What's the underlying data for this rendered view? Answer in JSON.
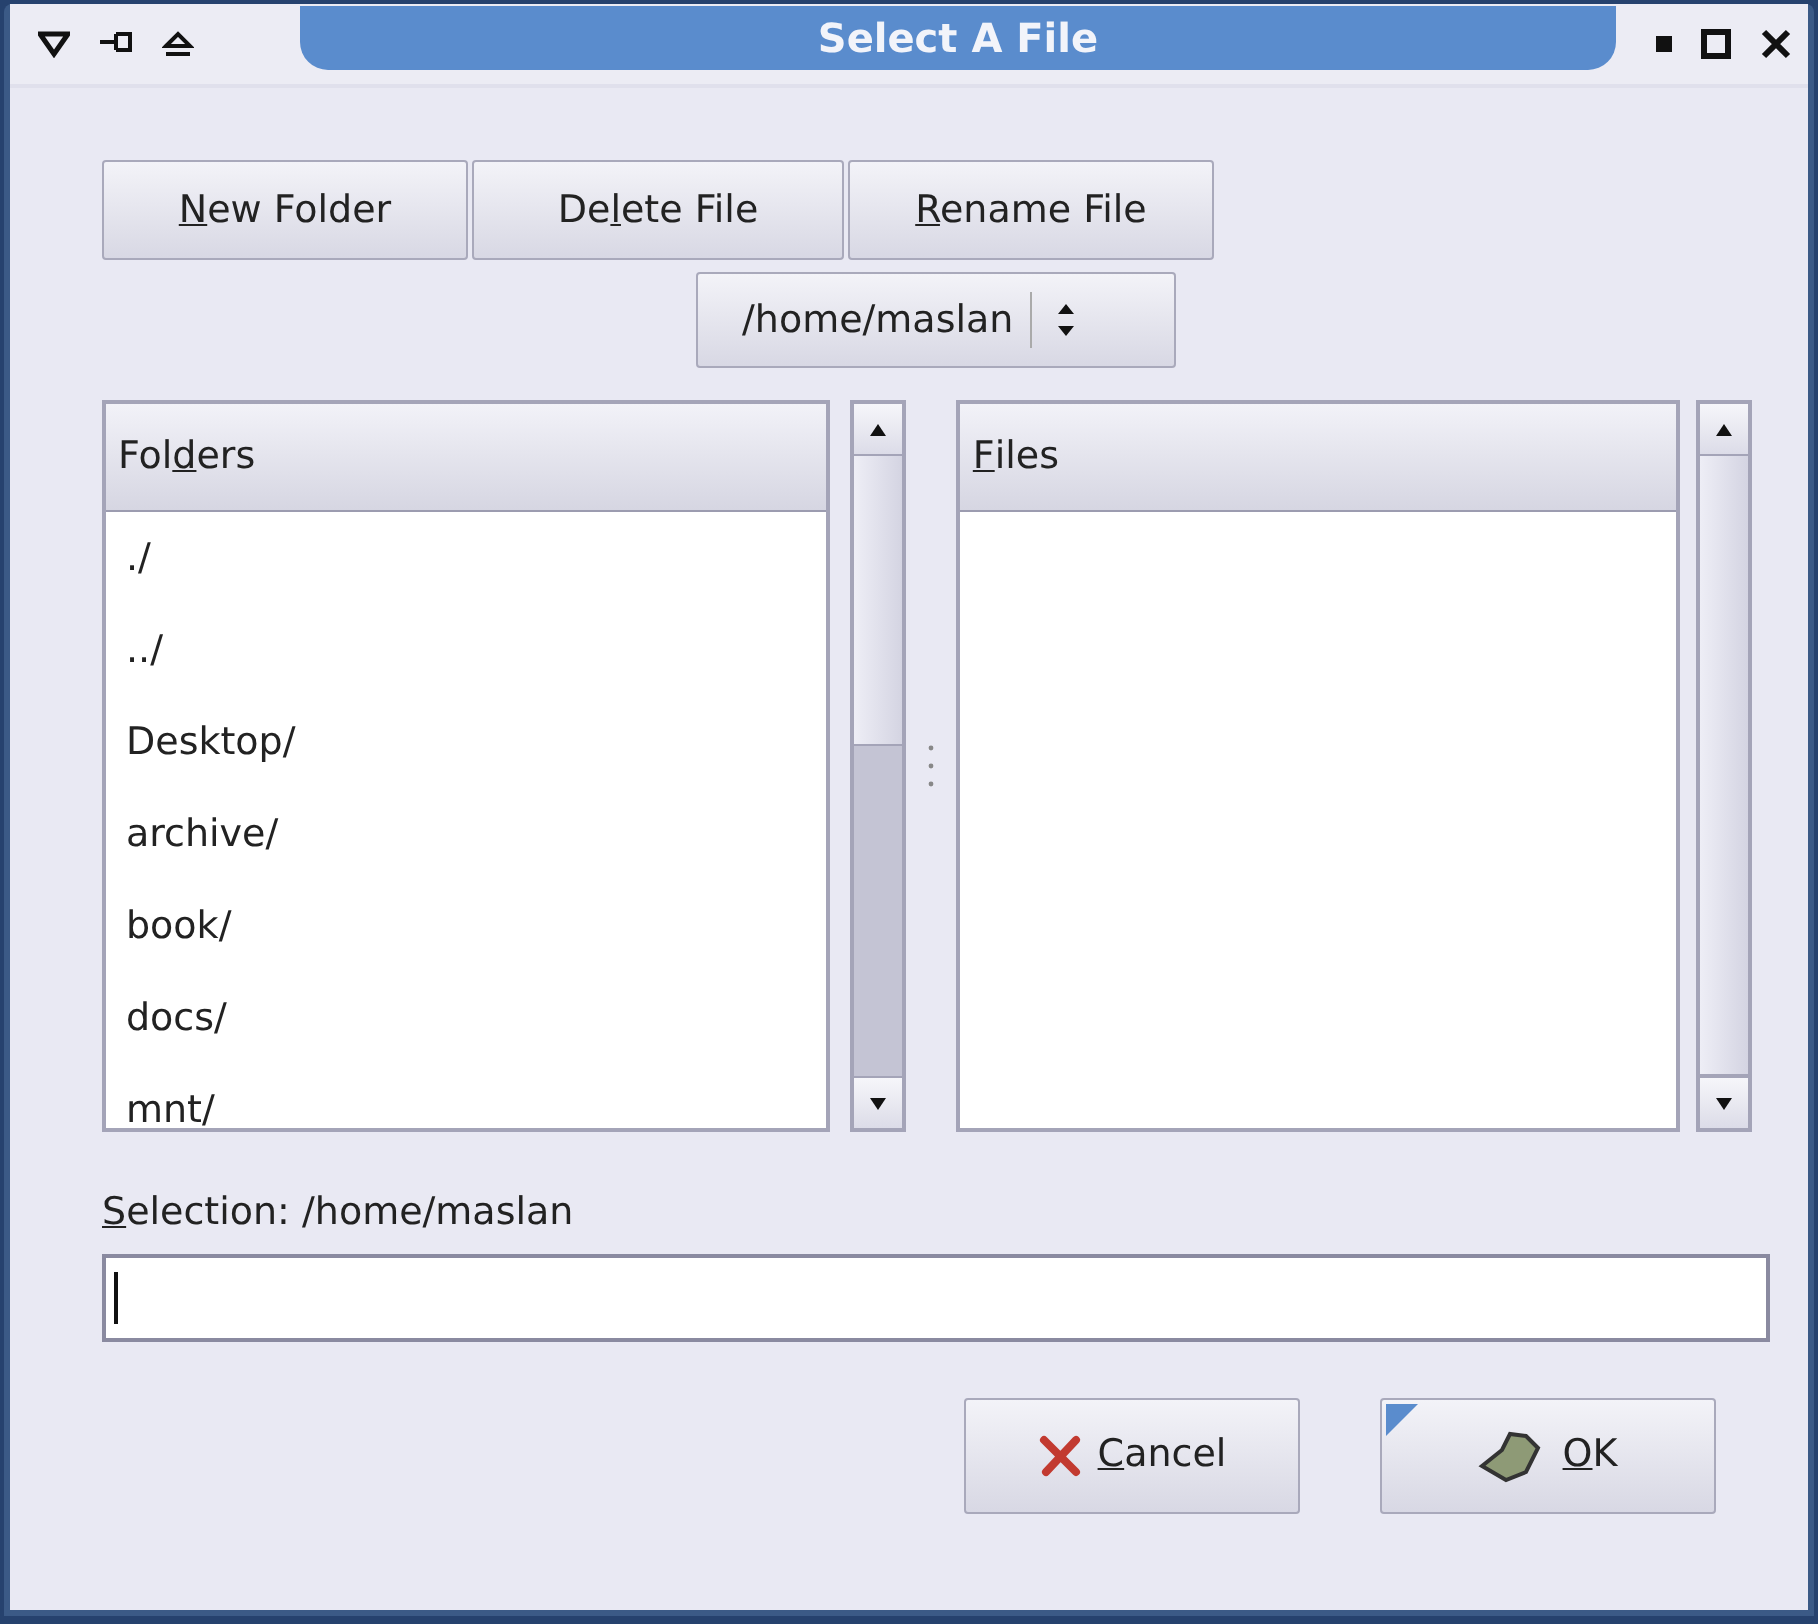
{
  "window": {
    "title": "Select A File"
  },
  "toolbar": [
    {
      "accel": "N",
      "after": "ew Folder"
    },
    {
      "before": "De",
      "accel": "l",
      "after": "ete File"
    },
    {
      "accel": "R",
      "after": "ename File"
    }
  ],
  "path_combo": {
    "value": "/home/maslan"
  },
  "folders": {
    "header": {
      "before": "Fol",
      "accel": "d",
      "after": "ers"
    },
    "items": [
      "./",
      "../",
      "Desktop/",
      "archive/",
      "book/",
      "docs/",
      "mnt/"
    ]
  },
  "files": {
    "header": {
      "accel": "F",
      "after": "iles"
    }
  },
  "selection": {
    "label": {
      "accel": "S",
      "after": "election: /home/maslan"
    },
    "focused": true
  },
  "buttons": [
    {
      "kind": "cancel",
      "label": {
        "accel": "C",
        "after": "ancel"
      },
      "default": false
    },
    {
      "kind": "ok",
      "label": {
        "accel": "O",
        "after": "K"
      },
      "default": true
    }
  ]
}
